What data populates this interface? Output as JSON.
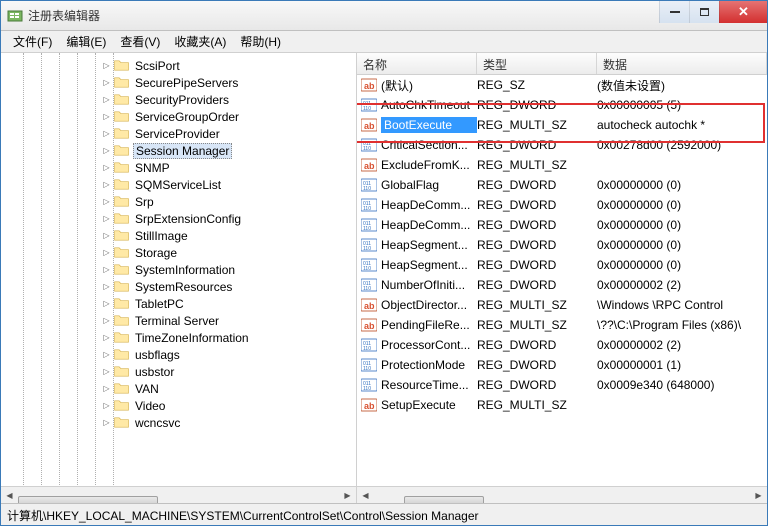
{
  "window": {
    "title": "注册表编辑器"
  },
  "menu": {
    "file": "文件(F)",
    "edit": "编辑(E)",
    "view": "查看(V)",
    "favorites": "收藏夹(A)",
    "help": "帮助(H)"
  },
  "tree": {
    "items": [
      {
        "label": "ScsiPort"
      },
      {
        "label": "SecurePipeServers"
      },
      {
        "label": "SecurityProviders"
      },
      {
        "label": "ServiceGroupOrder"
      },
      {
        "label": "ServiceProvider"
      },
      {
        "label": "Session Manager",
        "selected": true
      },
      {
        "label": "SNMP"
      },
      {
        "label": "SQMServiceList"
      },
      {
        "label": "Srp"
      },
      {
        "label": "SrpExtensionConfig"
      },
      {
        "label": "StillImage"
      },
      {
        "label": "Storage"
      },
      {
        "label": "SystemInformation"
      },
      {
        "label": "SystemResources"
      },
      {
        "label": "TabletPC"
      },
      {
        "label": "Terminal Server"
      },
      {
        "label": "TimeZoneInformation"
      },
      {
        "label": "usbflags"
      },
      {
        "label": "usbstor"
      },
      {
        "label": "VAN"
      },
      {
        "label": "Video"
      },
      {
        "label": "wcncsvc"
      }
    ]
  },
  "columns": {
    "name": "名称",
    "type": "类型",
    "data": "数据"
  },
  "values": [
    {
      "icon": "ab",
      "name": "(默认)",
      "type": "REG_SZ",
      "data": "(数值未设置)"
    },
    {
      "icon": "num",
      "name": "AutoChkTimeout",
      "type": "REG_DWORD",
      "data": "0x00000005 (5)"
    },
    {
      "icon": "ab",
      "name": "BootExecute",
      "type": "REG_MULTI_SZ",
      "data": "autocheck autochk *",
      "selected": true,
      "highlighted": true
    },
    {
      "icon": "num",
      "name": "CriticalSection...",
      "type": "REG_DWORD",
      "data": "0x00278d00 (2592000)"
    },
    {
      "icon": "ab",
      "name": "ExcludeFromK...",
      "type": "REG_MULTI_SZ",
      "data": ""
    },
    {
      "icon": "num",
      "name": "GlobalFlag",
      "type": "REG_DWORD",
      "data": "0x00000000 (0)"
    },
    {
      "icon": "num",
      "name": "HeapDeComm...",
      "type": "REG_DWORD",
      "data": "0x00000000 (0)"
    },
    {
      "icon": "num",
      "name": "HeapDeComm...",
      "type": "REG_DWORD",
      "data": "0x00000000 (0)"
    },
    {
      "icon": "num",
      "name": "HeapSegment...",
      "type": "REG_DWORD",
      "data": "0x00000000 (0)"
    },
    {
      "icon": "num",
      "name": "HeapSegment...",
      "type": "REG_DWORD",
      "data": "0x00000000 (0)"
    },
    {
      "icon": "num",
      "name": "NumberOfIniti...",
      "type": "REG_DWORD",
      "data": "0x00000002 (2)"
    },
    {
      "icon": "ab",
      "name": "ObjectDirector...",
      "type": "REG_MULTI_SZ",
      "data": "\\Windows \\RPC Control"
    },
    {
      "icon": "ab",
      "name": "PendingFileRe...",
      "type": "REG_MULTI_SZ",
      "data": "\\??\\C:\\Program Files (x86)\\"
    },
    {
      "icon": "num",
      "name": "ProcessorCont...",
      "type": "REG_DWORD",
      "data": "0x00000002 (2)"
    },
    {
      "icon": "num",
      "name": "ProtectionMode",
      "type": "REG_DWORD",
      "data": "0x00000001 (1)"
    },
    {
      "icon": "num",
      "name": "ResourceTime...",
      "type": "REG_DWORD",
      "data": "0x0009e340 (648000)"
    },
    {
      "icon": "ab",
      "name": "SetupExecute",
      "type": "REG_MULTI_SZ",
      "data": ""
    }
  ],
  "status": {
    "path": "计算机\\HKEY_LOCAL_MACHINE\\SYSTEM\\CurrentControlSet\\Control\\Session Manager"
  }
}
